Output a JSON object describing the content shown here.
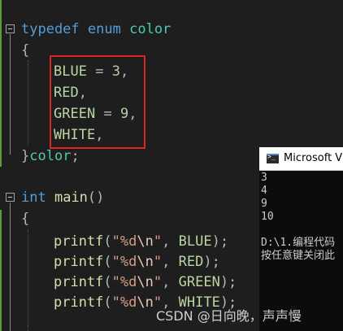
{
  "editor": {
    "code": {
      "kw_typedef": "typedef",
      "kw_enum": "enum",
      "enum_tag": "color",
      "brace_open": "{",
      "blue": "BLUE",
      "eq": "=",
      "blue_val": "3",
      "comma": ",",
      "red": "RED",
      "green": "GREEN",
      "green_val": "9",
      "white": "WHITE",
      "brace_close": "}",
      "type_name": "color",
      "semicolon": ";",
      "kw_int": "int",
      "main": "main",
      "parens": "()",
      "printf": "printf",
      "open_paren": "(",
      "fmt_start": "\"%d",
      "fmt_esc": "\\n",
      "fmt_end": "\"",
      "close_stmt": ");"
    }
  },
  "console": {
    "title": "Microsoft Vis",
    "output": [
      "3",
      "4",
      "9",
      "10",
      "",
      "D:\\1.编程代码",
      "按任意键关闭此"
    ]
  },
  "watermark": "CSDN @日向晚，声声慢",
  "colors": {
    "highlight_box": "#e02424",
    "editor_bg": "#1e1e1e",
    "gutter_bar": "#5c9c3a"
  }
}
